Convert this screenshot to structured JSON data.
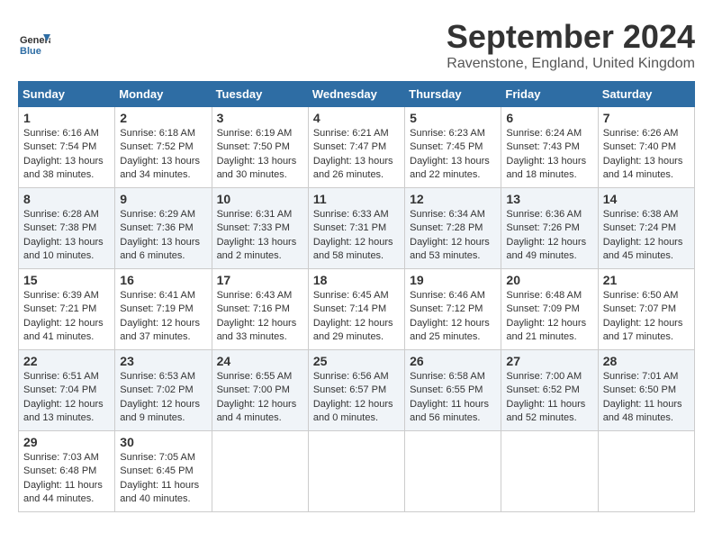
{
  "header": {
    "logo_line1": "General",
    "logo_line2": "Blue",
    "month_title": "September 2024",
    "location": "Ravenstone, England, United Kingdom"
  },
  "weekdays": [
    "Sunday",
    "Monday",
    "Tuesday",
    "Wednesday",
    "Thursday",
    "Friday",
    "Saturday"
  ],
  "weeks": [
    [
      {
        "day": "1",
        "sunrise": "Sunrise: 6:16 AM",
        "sunset": "Sunset: 7:54 PM",
        "daylight": "Daylight: 13 hours and 38 minutes."
      },
      {
        "day": "2",
        "sunrise": "Sunrise: 6:18 AM",
        "sunset": "Sunset: 7:52 PM",
        "daylight": "Daylight: 13 hours and 34 minutes."
      },
      {
        "day": "3",
        "sunrise": "Sunrise: 6:19 AM",
        "sunset": "Sunset: 7:50 PM",
        "daylight": "Daylight: 13 hours and 30 minutes."
      },
      {
        "day": "4",
        "sunrise": "Sunrise: 6:21 AM",
        "sunset": "Sunset: 7:47 PM",
        "daylight": "Daylight: 13 hours and 26 minutes."
      },
      {
        "day": "5",
        "sunrise": "Sunrise: 6:23 AM",
        "sunset": "Sunset: 7:45 PM",
        "daylight": "Daylight: 13 hours and 22 minutes."
      },
      {
        "day": "6",
        "sunrise": "Sunrise: 6:24 AM",
        "sunset": "Sunset: 7:43 PM",
        "daylight": "Daylight: 13 hours and 18 minutes."
      },
      {
        "day": "7",
        "sunrise": "Sunrise: 6:26 AM",
        "sunset": "Sunset: 7:40 PM",
        "daylight": "Daylight: 13 hours and 14 minutes."
      }
    ],
    [
      {
        "day": "8",
        "sunrise": "Sunrise: 6:28 AM",
        "sunset": "Sunset: 7:38 PM",
        "daylight": "Daylight: 13 hours and 10 minutes."
      },
      {
        "day": "9",
        "sunrise": "Sunrise: 6:29 AM",
        "sunset": "Sunset: 7:36 PM",
        "daylight": "Daylight: 13 hours and 6 minutes."
      },
      {
        "day": "10",
        "sunrise": "Sunrise: 6:31 AM",
        "sunset": "Sunset: 7:33 PM",
        "daylight": "Daylight: 13 hours and 2 minutes."
      },
      {
        "day": "11",
        "sunrise": "Sunrise: 6:33 AM",
        "sunset": "Sunset: 7:31 PM",
        "daylight": "Daylight: 12 hours and 58 minutes."
      },
      {
        "day": "12",
        "sunrise": "Sunrise: 6:34 AM",
        "sunset": "Sunset: 7:28 PM",
        "daylight": "Daylight: 12 hours and 53 minutes."
      },
      {
        "day": "13",
        "sunrise": "Sunrise: 6:36 AM",
        "sunset": "Sunset: 7:26 PM",
        "daylight": "Daylight: 12 hours and 49 minutes."
      },
      {
        "day": "14",
        "sunrise": "Sunrise: 6:38 AM",
        "sunset": "Sunset: 7:24 PM",
        "daylight": "Daylight: 12 hours and 45 minutes."
      }
    ],
    [
      {
        "day": "15",
        "sunrise": "Sunrise: 6:39 AM",
        "sunset": "Sunset: 7:21 PM",
        "daylight": "Daylight: 12 hours and 41 minutes."
      },
      {
        "day": "16",
        "sunrise": "Sunrise: 6:41 AM",
        "sunset": "Sunset: 7:19 PM",
        "daylight": "Daylight: 12 hours and 37 minutes."
      },
      {
        "day": "17",
        "sunrise": "Sunrise: 6:43 AM",
        "sunset": "Sunset: 7:16 PM",
        "daylight": "Daylight: 12 hours and 33 minutes."
      },
      {
        "day": "18",
        "sunrise": "Sunrise: 6:45 AM",
        "sunset": "Sunset: 7:14 PM",
        "daylight": "Daylight: 12 hours and 29 minutes."
      },
      {
        "day": "19",
        "sunrise": "Sunrise: 6:46 AM",
        "sunset": "Sunset: 7:12 PM",
        "daylight": "Daylight: 12 hours and 25 minutes."
      },
      {
        "day": "20",
        "sunrise": "Sunrise: 6:48 AM",
        "sunset": "Sunset: 7:09 PM",
        "daylight": "Daylight: 12 hours and 21 minutes."
      },
      {
        "day": "21",
        "sunrise": "Sunrise: 6:50 AM",
        "sunset": "Sunset: 7:07 PM",
        "daylight": "Daylight: 12 hours and 17 minutes."
      }
    ],
    [
      {
        "day": "22",
        "sunrise": "Sunrise: 6:51 AM",
        "sunset": "Sunset: 7:04 PM",
        "daylight": "Daylight: 12 hours and 13 minutes."
      },
      {
        "day": "23",
        "sunrise": "Sunrise: 6:53 AM",
        "sunset": "Sunset: 7:02 PM",
        "daylight": "Daylight: 12 hours and 9 minutes."
      },
      {
        "day": "24",
        "sunrise": "Sunrise: 6:55 AM",
        "sunset": "Sunset: 7:00 PM",
        "daylight": "Daylight: 12 hours and 4 minutes."
      },
      {
        "day": "25",
        "sunrise": "Sunrise: 6:56 AM",
        "sunset": "Sunset: 6:57 PM",
        "daylight": "Daylight: 12 hours and 0 minutes."
      },
      {
        "day": "26",
        "sunrise": "Sunrise: 6:58 AM",
        "sunset": "Sunset: 6:55 PM",
        "daylight": "Daylight: 11 hours and 56 minutes."
      },
      {
        "day": "27",
        "sunrise": "Sunrise: 7:00 AM",
        "sunset": "Sunset: 6:52 PM",
        "daylight": "Daylight: 11 hours and 52 minutes."
      },
      {
        "day": "28",
        "sunrise": "Sunrise: 7:01 AM",
        "sunset": "Sunset: 6:50 PM",
        "daylight": "Daylight: 11 hours and 48 minutes."
      }
    ],
    [
      {
        "day": "29",
        "sunrise": "Sunrise: 7:03 AM",
        "sunset": "Sunset: 6:48 PM",
        "daylight": "Daylight: 11 hours and 44 minutes."
      },
      {
        "day": "30",
        "sunrise": "Sunrise: 7:05 AM",
        "sunset": "Sunset: 6:45 PM",
        "daylight": "Daylight: 11 hours and 40 minutes."
      },
      null,
      null,
      null,
      null,
      null
    ]
  ]
}
